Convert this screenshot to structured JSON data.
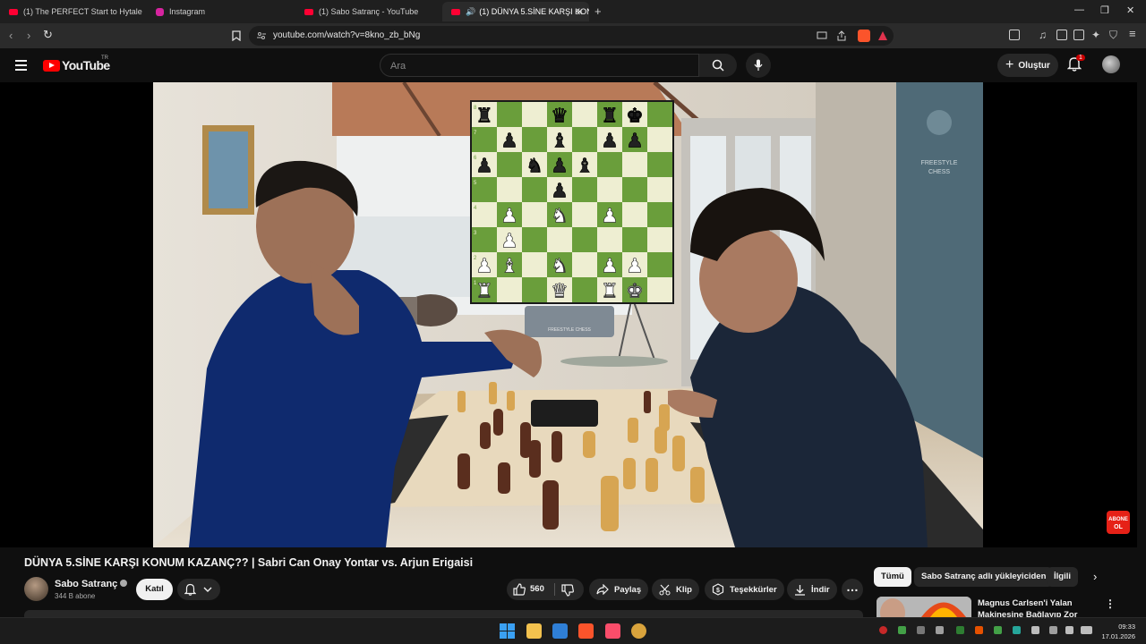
{
  "browser": {
    "tabs": [
      {
        "label": "(1) The PERFECT Start to Hytale - You"
      },
      {
        "label": "Instagram"
      },
      {
        "label": "(1) Sabo Satranç - YouTube"
      },
      {
        "label": "(1) DÜNYA 5.SİNE KARŞI KON"
      }
    ],
    "url": "youtube.com/watch?v=8kno_zb_bNg"
  },
  "yt": {
    "logo_text": "YouTube",
    "country_code": "TR",
    "search_placeholder": "Ara",
    "create_label": "Oluştur",
    "notification_count": "1"
  },
  "video": {
    "title": "DÜNYA 5.SİNE KARŞI KONUM KAZANÇ?? | Sabri Can Onay Yontar vs. Arjun Erigaisi",
    "channel": "Sabo Satranç",
    "subscribers": "344 B abone",
    "join_label": "Katıl",
    "likes": "560",
    "share_label": "Paylaş",
    "clip_label": "Klip",
    "thanks_label": "Teşekkürler",
    "download_label": "İndir"
  },
  "board": {
    "ranks": [
      "8",
      "7",
      "6",
      "5",
      "4",
      "3",
      "2",
      "1"
    ],
    "pieces": [
      "r..q.rk.",
      ".p.b.pp.",
      "p.npb...",
      "...p....",
      ".P.N.P..",
      ".P......",
      "PB.N.PP.",
      "R..Q.RK."
    ]
  },
  "banner": {
    "line1": "FREESTYLE",
    "line2": "CHESS"
  },
  "clock_label": "FREESTYLE CHESS",
  "overlay_badge": {
    "line1": "ABONE",
    "line2": "OL"
  },
  "sidebar": {
    "chips": [
      "Tümü",
      "Sabo Satranç adlı yükleyiciden",
      "İlgili"
    ],
    "recommendation_title": "Magnus Carlsen'i Yalan Makinesine Bağlayıp Zor"
  },
  "system": {
    "time": "09:33",
    "date": "17.01.2026"
  },
  "colors": {
    "light_square": "#eeeed2",
    "dark_square": "#6a9e3b",
    "youtube_red": "#ff0000",
    "background": "#0f0f0f"
  }
}
